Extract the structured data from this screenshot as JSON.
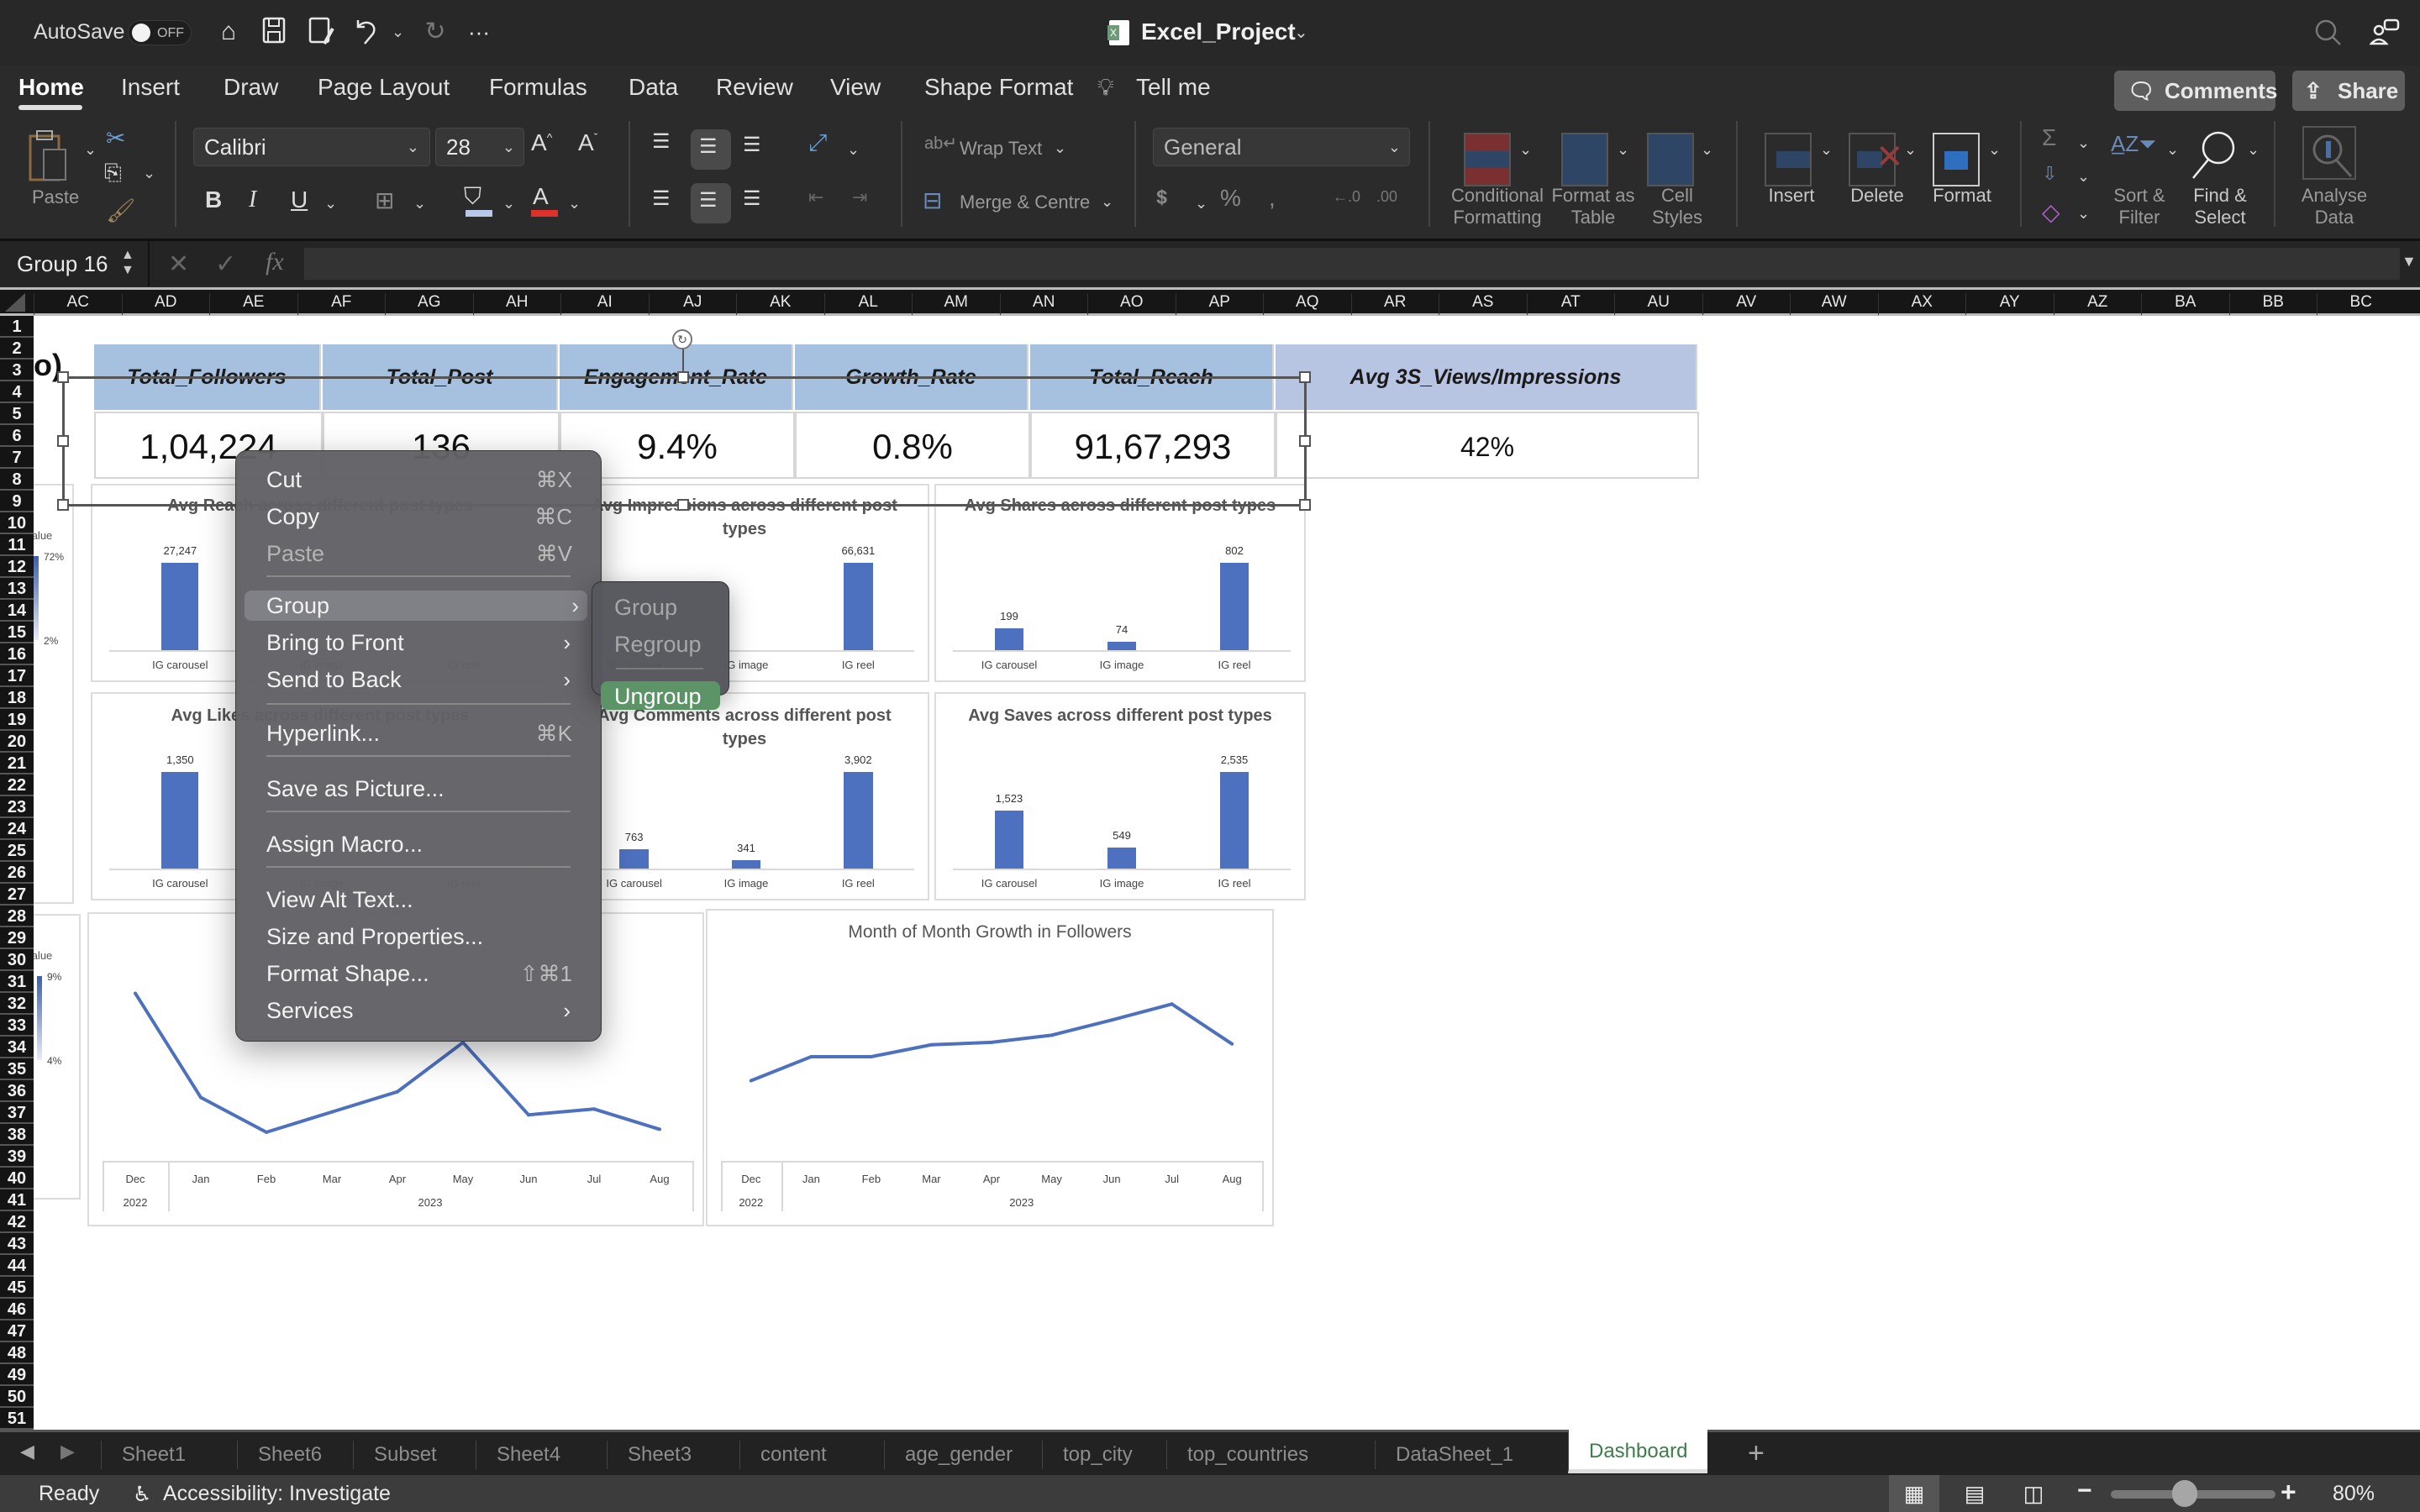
{
  "titlebar": {
    "autosave_label": "AutoSave",
    "autosave_state": "OFF",
    "document_title": "Excel_Project",
    "quick_access": [
      "home-icon",
      "save-icon",
      "save-as-icon",
      "undo-icon",
      "redo-icon",
      "more-icon"
    ]
  },
  "ribbon_tabs": [
    "Home",
    "Insert",
    "Draw",
    "Page Layout",
    "Formulas",
    "Data",
    "Review",
    "View",
    "Shape Format"
  ],
  "tell_me": "Tell me",
  "comments_label": "Comments",
  "share_label": "Share",
  "ribbon": {
    "paste_label": "Paste",
    "font_name": "Calibri",
    "font_size": "28",
    "wrap_text_label": "Wrap Text",
    "merge_label": "Merge & Centre",
    "number_format": "General",
    "conditional_formatting": "Conditional Formatting",
    "format_as_table": "Format as Table",
    "cell_styles": "Cell Styles",
    "insert": "Insert",
    "delete": "Delete",
    "format": "Format",
    "sort_filter": "Sort & Filter",
    "find_select": "Find & Select",
    "analyse_data": "Analyse Data",
    "fill_color": "#b9c8e8",
    "font_color": "#e0302a"
  },
  "formula_bar": {
    "name_box": "Group 16",
    "formula": ""
  },
  "columns": [
    "AC",
    "AD",
    "AE",
    "AF",
    "AG",
    "AH",
    "AI",
    "AJ",
    "AK",
    "AL",
    "AM",
    "AN",
    "AO",
    "AP",
    "AQ",
    "AR",
    "AS",
    "AT",
    "AU",
    "AV",
    "AW",
    "AX",
    "AY",
    "AZ",
    "BA",
    "BB",
    "BC"
  ],
  "rows_visible": {
    "first": 1,
    "last": 51
  },
  "partial_cell_text": "o)",
  "kpis": [
    {
      "label": "Total_Followers",
      "value": "1,04,224"
    },
    {
      "label": "Total_Post",
      "value": "136"
    },
    {
      "label": "Engagement_Rate",
      "value": "9.4%"
    },
    {
      "label": "Growth_Rate",
      "value": "0.8%"
    },
    {
      "label": "Total_Reach",
      "value": "91,67,293"
    },
    {
      "label": "Avg 3S_Views/Impressions",
      "value": "42%"
    }
  ],
  "heat_legend_top": {
    "title": "Value",
    "max": "72%",
    "min": "2%"
  },
  "heat_legend_bottom": {
    "title": "Value",
    "max": "9%",
    "min": "4%"
  },
  "chart_data": [
    {
      "type": "bar",
      "title": "Avg Reach across different post types",
      "title_visible_fragment": "Avg Reach",
      "categories": [
        "IG carousel",
        "IG image",
        "IG reel"
      ],
      "values": [
        27247,
        null,
        null
      ],
      "data_labels": [
        "27,247",
        "",
        ""
      ]
    },
    {
      "type": "bar",
      "title": "Avg Impressions across different post types",
      "categories": [
        "IG carousel",
        "IG image",
        "IG reel"
      ],
      "values": [
        null,
        null,
        66631
      ],
      "data_labels": [
        "",
        "",
        "66,631"
      ]
    },
    {
      "type": "bar",
      "title": "Avg Shares across different post types",
      "categories": [
        "IG carousel",
        "IG image",
        "IG reel"
      ],
      "values": [
        199,
        74,
        802
      ],
      "data_labels": [
        "199",
        "74",
        "802"
      ]
    },
    {
      "type": "bar",
      "title": "Avg Likes across different post types",
      "title_visible_fragment": "Avg Likes",
      "categories": [
        "IG carousel",
        "IG image",
        "IG reel"
      ],
      "values": [
        1350,
        null,
        null
      ],
      "data_labels": [
        "1,350",
        "",
        ""
      ]
    },
    {
      "type": "bar",
      "title": "Avg Comments across different post types",
      "title_visible_fragment": "ss different post types",
      "categories": [
        "IG carousel",
        "IG image",
        "IG reel"
      ],
      "values": [
        763,
        341,
        3902
      ],
      "data_labels": [
        "763",
        "341",
        "3,902"
      ]
    },
    {
      "type": "bar",
      "title": "Avg Saves across different post types",
      "categories": [
        "IG carousel",
        "IG image",
        "IG reel"
      ],
      "values": [
        1523,
        549,
        2535
      ],
      "data_labels": [
        "1,523",
        "549",
        "2,535"
      ]
    },
    {
      "type": "line",
      "title": "",
      "categories": [
        "Dec",
        "Jan",
        "Feb",
        "Mar",
        "Apr",
        "May",
        "Jun",
        "Jul",
        "Aug"
      ],
      "year_groups": [
        {
          "label": "2022",
          "span": 1
        },
        {
          "label": "2023",
          "span": 8
        }
      ],
      "values": [
        9.0,
        5.4,
        4.2,
        4.9,
        5.6,
        7.3,
        4.8,
        5.0,
        4.3
      ],
      "ylim": [
        3.5,
        10
      ]
    },
    {
      "type": "line",
      "title": "Month of Month Growth in Followers",
      "categories": [
        "Dec",
        "Jan",
        "Feb",
        "Mar",
        "Apr",
        "May",
        "Jun",
        "Jul",
        "Aug"
      ],
      "year_groups": [
        {
          "label": "2022",
          "span": 1
        },
        {
          "label": "2023",
          "span": 8
        }
      ],
      "values": [
        0.45,
        0.6,
        0.6,
        0.675,
        0.69,
        0.735,
        0.83,
        0.93,
        0.68
      ],
      "ylim": [
        0,
        1.2
      ]
    }
  ],
  "context_menu": {
    "items": [
      {
        "label": "Cut",
        "shortcut": "⌘X",
        "enabled": true
      },
      {
        "label": "Copy",
        "shortcut": "⌘C",
        "enabled": true
      },
      {
        "label": "Paste",
        "shortcut": "⌘V",
        "enabled": false
      },
      {
        "label": "Group",
        "submenu": true,
        "highlighted": true
      },
      {
        "label": "Bring to Front",
        "submenu": true
      },
      {
        "label": "Send to Back",
        "submenu": true
      },
      {
        "label": "Hyperlink...",
        "shortcut": "⌘K"
      },
      {
        "label": "Save as Picture..."
      },
      {
        "label": "Assign Macro..."
      },
      {
        "label": "View Alt Text..."
      },
      {
        "label": "Size and Properties..."
      },
      {
        "label": "Format Shape...",
        "shortcut": "⇧⌘1"
      },
      {
        "label": "Services",
        "submenu": true
      }
    ],
    "submenu": [
      {
        "label": "Group",
        "enabled": false
      },
      {
        "label": "Regroup",
        "enabled": false
      },
      {
        "label": "Ungroup",
        "enabled": true,
        "highlighted": true
      }
    ]
  },
  "sheet_tabs": [
    "Sheet1",
    "Sheet6",
    "Subset",
    "Sheet4",
    "Sheet3",
    "content",
    "age_gender",
    "top_city",
    "top_countries",
    "DataSheet_1",
    "Dashboard"
  ],
  "active_sheet": "Dashboard",
  "status": {
    "ready": "Ready",
    "accessibility": "Accessibility: Investigate",
    "zoom": "80%",
    "zoom_slider_fraction": 0.45
  }
}
